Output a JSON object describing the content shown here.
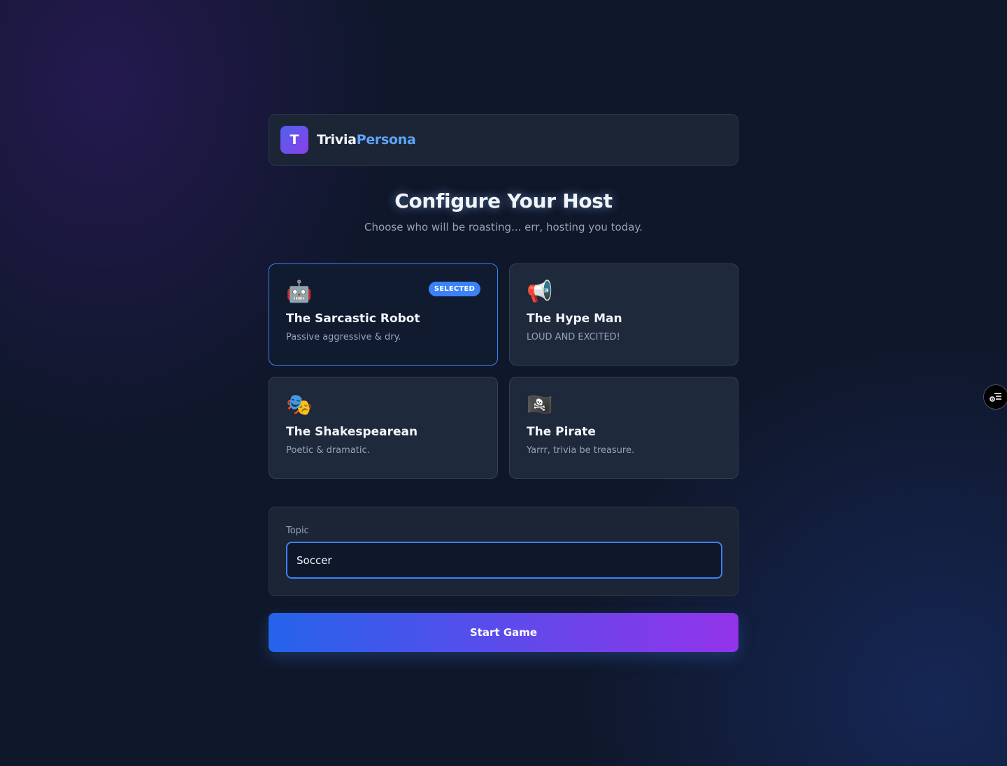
{
  "header": {
    "logo_letter": "T",
    "brand_part1": "Trivia",
    "brand_part2": "Persona"
  },
  "page": {
    "title": "Configure Your Host",
    "subtitle": "Choose who will be roasting... err, hosting you today."
  },
  "personas": [
    {
      "emoji": "🤖",
      "name": "The Sarcastic Robot",
      "description": "Passive aggressive & dry.",
      "selected": true,
      "badge": "SELECTED"
    },
    {
      "emoji": "📢",
      "name": "The Hype Man",
      "description": "LOUD AND EXCITED!",
      "selected": false
    },
    {
      "emoji": "🎭",
      "name": "The Shakespearean",
      "description": "Poetic & dramatic.",
      "selected": false
    },
    {
      "emoji": "🏴‍☠️",
      "name": "The Pirate",
      "description": "Yarrr, trivia be treasure.",
      "selected": false
    }
  ],
  "topic": {
    "label": "Topic",
    "value": "Soccer"
  },
  "start_button": {
    "label": "Start Game"
  },
  "side_widget": {
    "icon": "list-widget-icon"
  },
  "colors": {
    "accent_blue": "#3b82f6",
    "brand_blue": "#60a5fa",
    "gradient_start": "#2563eb",
    "gradient_end": "#9333ea",
    "background": "#0f172a"
  }
}
